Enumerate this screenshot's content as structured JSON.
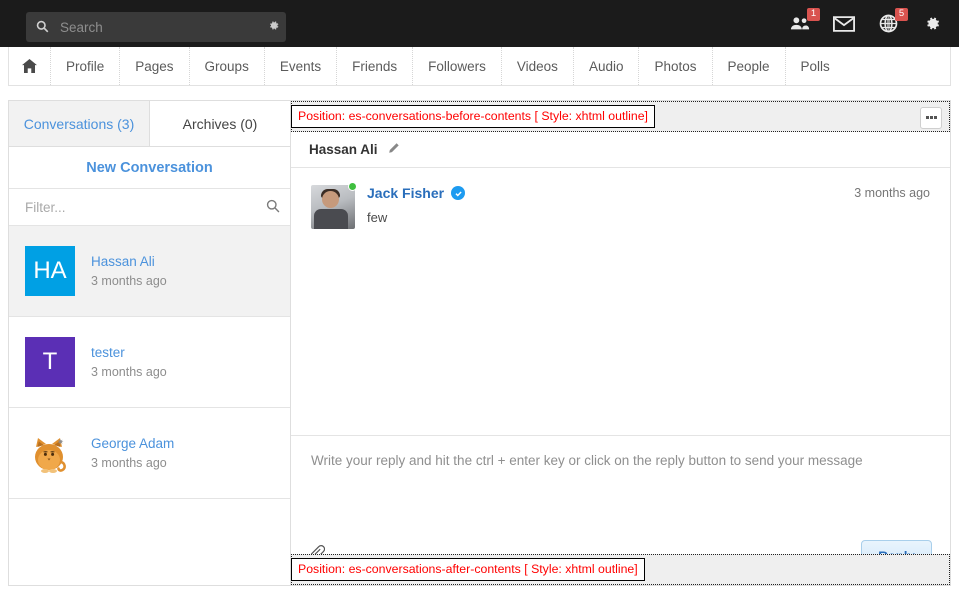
{
  "topbar": {
    "search": {
      "placeholder": "Search",
      "value": "",
      "icon": "search-icon",
      "settings_icon": "gear-icon"
    },
    "icons": [
      {
        "name": "friends-icon",
        "badge": "1"
      },
      {
        "name": "messages-envelope-icon",
        "badge": ""
      },
      {
        "name": "globe-notifications-icon",
        "badge": "5"
      },
      {
        "name": "settings-gear-icon",
        "badge": ""
      }
    ]
  },
  "nav": {
    "home_label": "⌂",
    "items": [
      {
        "label": "Profile"
      },
      {
        "label": "Pages"
      },
      {
        "label": "Groups"
      },
      {
        "label": "Events"
      },
      {
        "label": "Friends"
      },
      {
        "label": "Followers"
      },
      {
        "label": "Videos"
      },
      {
        "label": "Audio"
      },
      {
        "label": "Photos"
      },
      {
        "label": "People"
      },
      {
        "label": "Polls"
      }
    ]
  },
  "sidebar": {
    "tabs": [
      {
        "label": "Conversations (3)",
        "active": true
      },
      {
        "label": "Archives (0)",
        "active": false
      }
    ],
    "new_conversation_label": "New Conversation",
    "filter": {
      "placeholder": "Filter...",
      "value": "",
      "icon": "search-icon"
    },
    "conversations": [
      {
        "name": "Hassan Ali",
        "time": "3 months ago",
        "avatar_type": "initials",
        "initials": "HA",
        "avatar_color": "#00a0e4",
        "selected": true
      },
      {
        "name": "tester",
        "time": "3 months ago",
        "avatar_type": "initials",
        "initials": "T",
        "avatar_color": "#5b2fb5",
        "selected": false
      },
      {
        "name": "George Adam",
        "time": "3 months ago",
        "avatar_type": "image",
        "initials": "",
        "avatar_color": "#e0902f",
        "selected": false
      }
    ]
  },
  "main": {
    "annotation_top": "Position: es-conversations-before-contents [ Style: xhtml outline]",
    "annotation_bottom": "Position: es-conversations-after-contents [ Style: xhtml outline]",
    "more_button_label": "▪▪▪",
    "conversation_title": "Hassan Ali",
    "edit_icon": "pencil-icon",
    "messages": [
      {
        "author": "Jack Fisher",
        "verified": true,
        "time": "3 months ago",
        "text": "few",
        "online": true
      }
    ],
    "reply": {
      "placeholder": "Write your reply and hit the ctrl + enter key or click on the reply button to send your message",
      "value": "",
      "attach_icon": "paperclip-icon",
      "button_label": "Reply"
    }
  },
  "colors": {
    "accent_blue": "#4b92dc",
    "link_blue": "#2a6ebb",
    "badge_red": "#d9534f",
    "annotation_red": "#ff0000",
    "topbar_black": "#1b1b1b"
  }
}
